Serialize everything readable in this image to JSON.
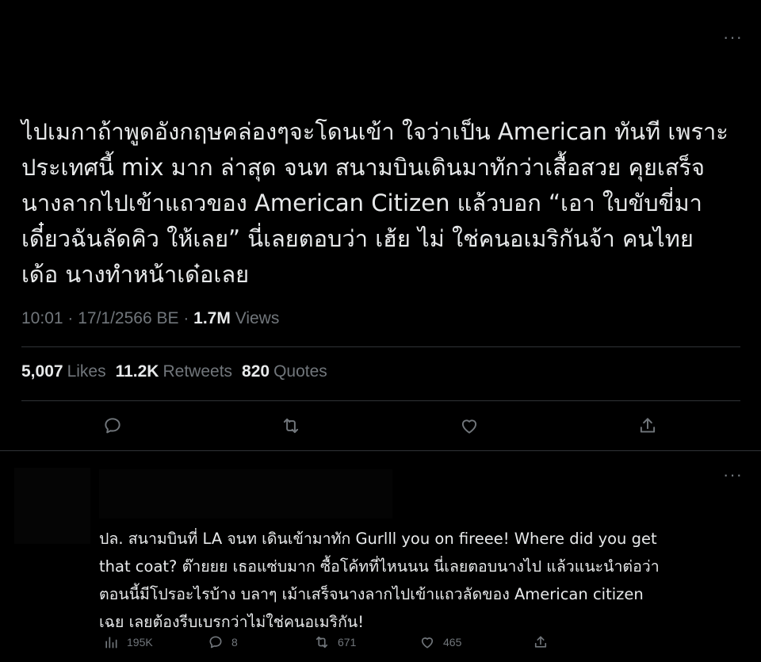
{
  "tweet": {
    "more_icon": "···",
    "text": "ไปเมกาถ้าพูดอังกฤษคล่องๆจะโดนเข้า ใจว่าเป็น American ทันที เพราะ\nประเทศนี้ mix มาก ล่าสุด จนท สนามบินเดินมาทักว่าเสื้อสวย คุยเสร็จ\nนางลากไปเข้าแถวของ American Citizen แล้วบอก “เอา ใบขับขี่มา\nเดี๋ยวฉันลัดคิว ให้เลย” นี่เลยตอบว่า เฮ้ย ไม่ ใช่คนอเมริกันจ้า คนไทย\nเด้อ นางทำหน้าเด๋อเลย",
    "time": "10:01 · 17/1/2566 BE ·",
    "views_count": "1.7M",
    "views_label": "Views",
    "likes_count": "5,007",
    "likes_label": "Likes",
    "retweets_count": "11.2K",
    "retweets_label": "Retweets",
    "quotes_count": "820",
    "quotes_label": "Quotes",
    "actions": [
      "reply-icon",
      "retweet-icon",
      "like-icon",
      "share-icon"
    ]
  },
  "reply": {
    "more_icon": "···",
    "text": "ปล. สนามบินที่ LA จนท เดินเข้ามาทัก Gurlll you on fireee! Where did you get\nthat coat? ต๊ายยย เธอแซ่บมาก ซื้อโค้ทที่ไหนนน นี่เลยตอบนางไป แล้วแนะนำต่อว่า\nตอนนี้มีโปรอะไรบ้าง บลาๆ เม้าเสร็จนางลากไปเข้าแถวลัดของ American citizen\nเฉย เลยต้องรีบเบรกว่าไม่ใช่คนอเมริกัน!",
    "views": "195K",
    "replies": "8",
    "retweets": "671",
    "likes": "465"
  },
  "colors": {
    "background": "#000000",
    "text": "#e7e9ea",
    "muted": "#71767b",
    "divider": "#2f3336"
  }
}
